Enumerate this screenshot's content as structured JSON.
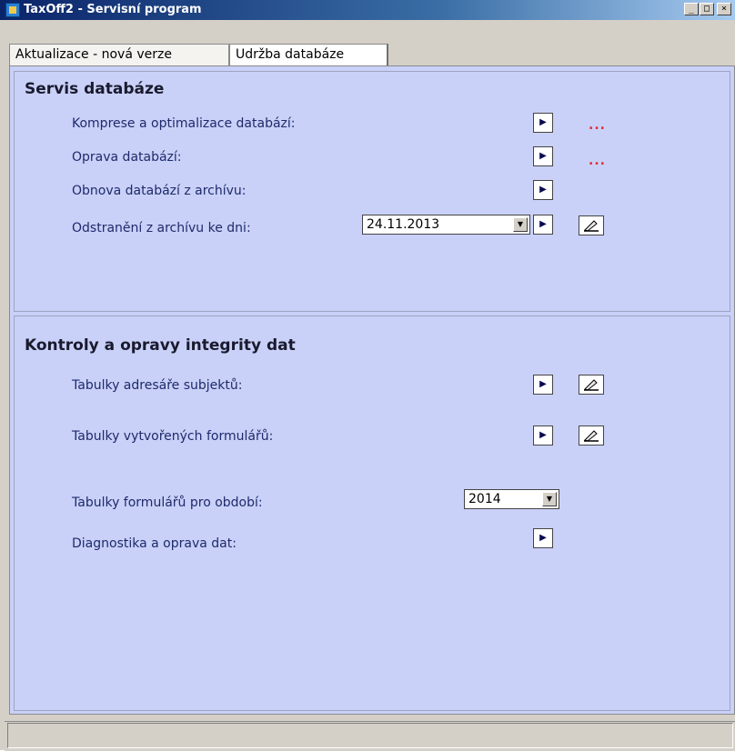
{
  "window": {
    "title": "TaxOff2 - Servisní program",
    "controls": {
      "minimize": "_",
      "maximize": "□",
      "close": "×"
    }
  },
  "tabs": [
    {
      "label": "Aktualizace - nová verze",
      "active": false
    },
    {
      "label": "Udržba databáze",
      "active": true
    }
  ],
  "db_service": {
    "title": "Servis databáze",
    "compress_label": "Komprese a optimalizace databází:",
    "compress_status": "...",
    "repair_label": "Oprava databází:",
    "repair_status": "...",
    "restore_label": "Obnova databází z archívu:",
    "remove_label": "Odstranění z archívu ke dni:",
    "remove_date": "24.11.2013"
  },
  "integrity": {
    "title": "Kontroly a opravy integrity dat",
    "address_tables_label": "Tabulky adresáře subjektů:",
    "forms_tables_label": "Tabulky vytvořených formulářů:",
    "period_label": "Tabulky formulářů pro období:",
    "period_value": "2014",
    "diagnostics_label": "Diagnostika a oprava dat:"
  },
  "icons": {
    "run": "run-arrow-icon",
    "edit": "pen-edit-icon",
    "dropdown": "chevron-down-icon",
    "app": "app-icon"
  },
  "colors": {
    "panel_bg": "#c9d1f8",
    "label_text": "#1f2a6b",
    "status_dots": "#e03030"
  },
  "status_bar": {
    "text": ""
  }
}
